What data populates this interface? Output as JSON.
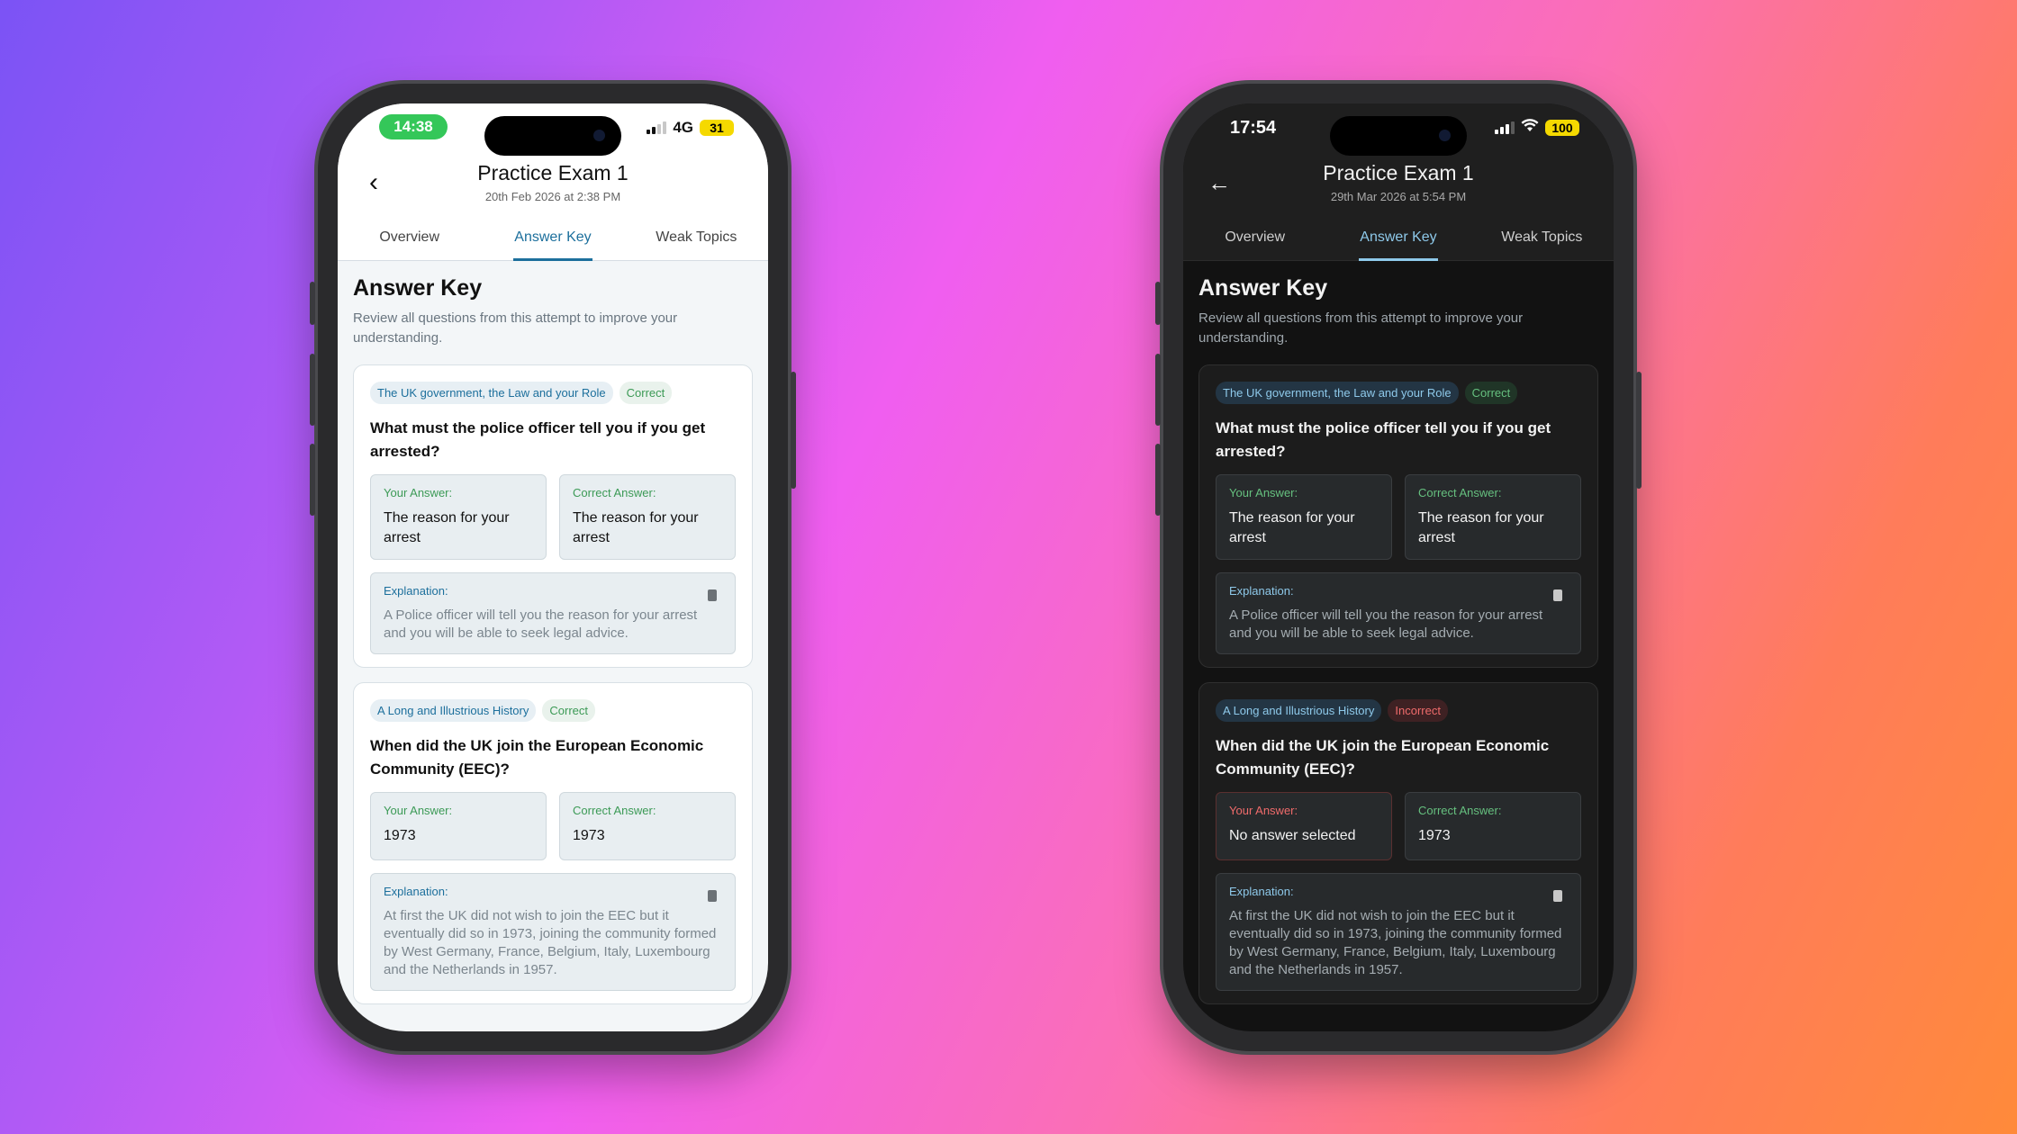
{
  "light": {
    "status_time": "14:38",
    "network": "4G",
    "battery": "31",
    "title": "Practice Exam 1",
    "subtitle": "20th Feb 2026 at 2:38 PM",
    "tabs": [
      "Overview",
      "Answer Key",
      "Weak Topics"
    ],
    "heading": "Answer Key",
    "description": "Review all questions from this attempt to improve your understanding.",
    "cards": [
      {
        "topic": "The UK government, the Law and your Role",
        "status": "Correct",
        "question": "What must the police officer tell you if you get arrested?",
        "your_answer_label": "Your Answer:",
        "your_answer": "The reason for your arrest",
        "correct_answer_label": "Correct Answer:",
        "correct_answer": "The reason for your arrest",
        "explanation_label": "Explanation:",
        "explanation": "A Police officer will tell you the reason for your arrest and you will be able to seek legal advice."
      },
      {
        "topic": "A Long and Illustrious History",
        "status": "Correct",
        "question": "When did the UK join the European Economic Community (EEC)?",
        "your_answer_label": "Your Answer:",
        "your_answer": "1973",
        "correct_answer_label": "Correct Answer:",
        "correct_answer": "1973",
        "explanation_label": "Explanation:",
        "explanation": "At first the UK did not wish to join the EEC but it eventually did so in 1973, joining the community formed by West Germany, France, Belgium, Italy, Luxembourg and the Netherlands in 1957."
      }
    ]
  },
  "dark": {
    "status_time": "17:54",
    "battery": "100",
    "title": "Practice Exam 1",
    "subtitle": "29th Mar 2026 at 5:54 PM",
    "tabs": [
      "Overview",
      "Answer Key",
      "Weak Topics"
    ],
    "heading": "Answer Key",
    "description": "Review all questions from this attempt to improve your understanding.",
    "cards": [
      {
        "topic": "The UK government, the Law and your Role",
        "status": "Correct",
        "question": "What must the police officer tell you if you get arrested?",
        "your_answer_label": "Your Answer:",
        "your_answer": "The reason for your arrest",
        "correct_answer_label": "Correct Answer:",
        "correct_answer": "The reason for your arrest",
        "explanation_label": "Explanation:",
        "explanation": "A Police officer will tell you the reason for your arrest and you will be able to seek legal advice."
      },
      {
        "topic": "A Long and Illustrious History",
        "status": "Incorrect",
        "question": "When did the UK join the European Economic Community (EEC)?",
        "your_answer_label": "Your Answer:",
        "your_answer": "No answer selected",
        "correct_answer_label": "Correct Answer:",
        "correct_answer": "1973",
        "explanation_label": "Explanation:",
        "explanation": "At first the UK did not wish to join the EEC but it eventually did so in 1973, joining the community formed by West Germany, France, Belgium, Italy, Luxembourg and the Netherlands in 1957."
      }
    ]
  },
  "colors": {
    "accent_light": "#1c6f9c",
    "accent_dark": "#8ec9ea",
    "correct_green": "#3c9a56",
    "incorrect_red": "#ef6b6b",
    "battery_yellow": "#f5d900",
    "time_pill_green": "#34c759"
  }
}
